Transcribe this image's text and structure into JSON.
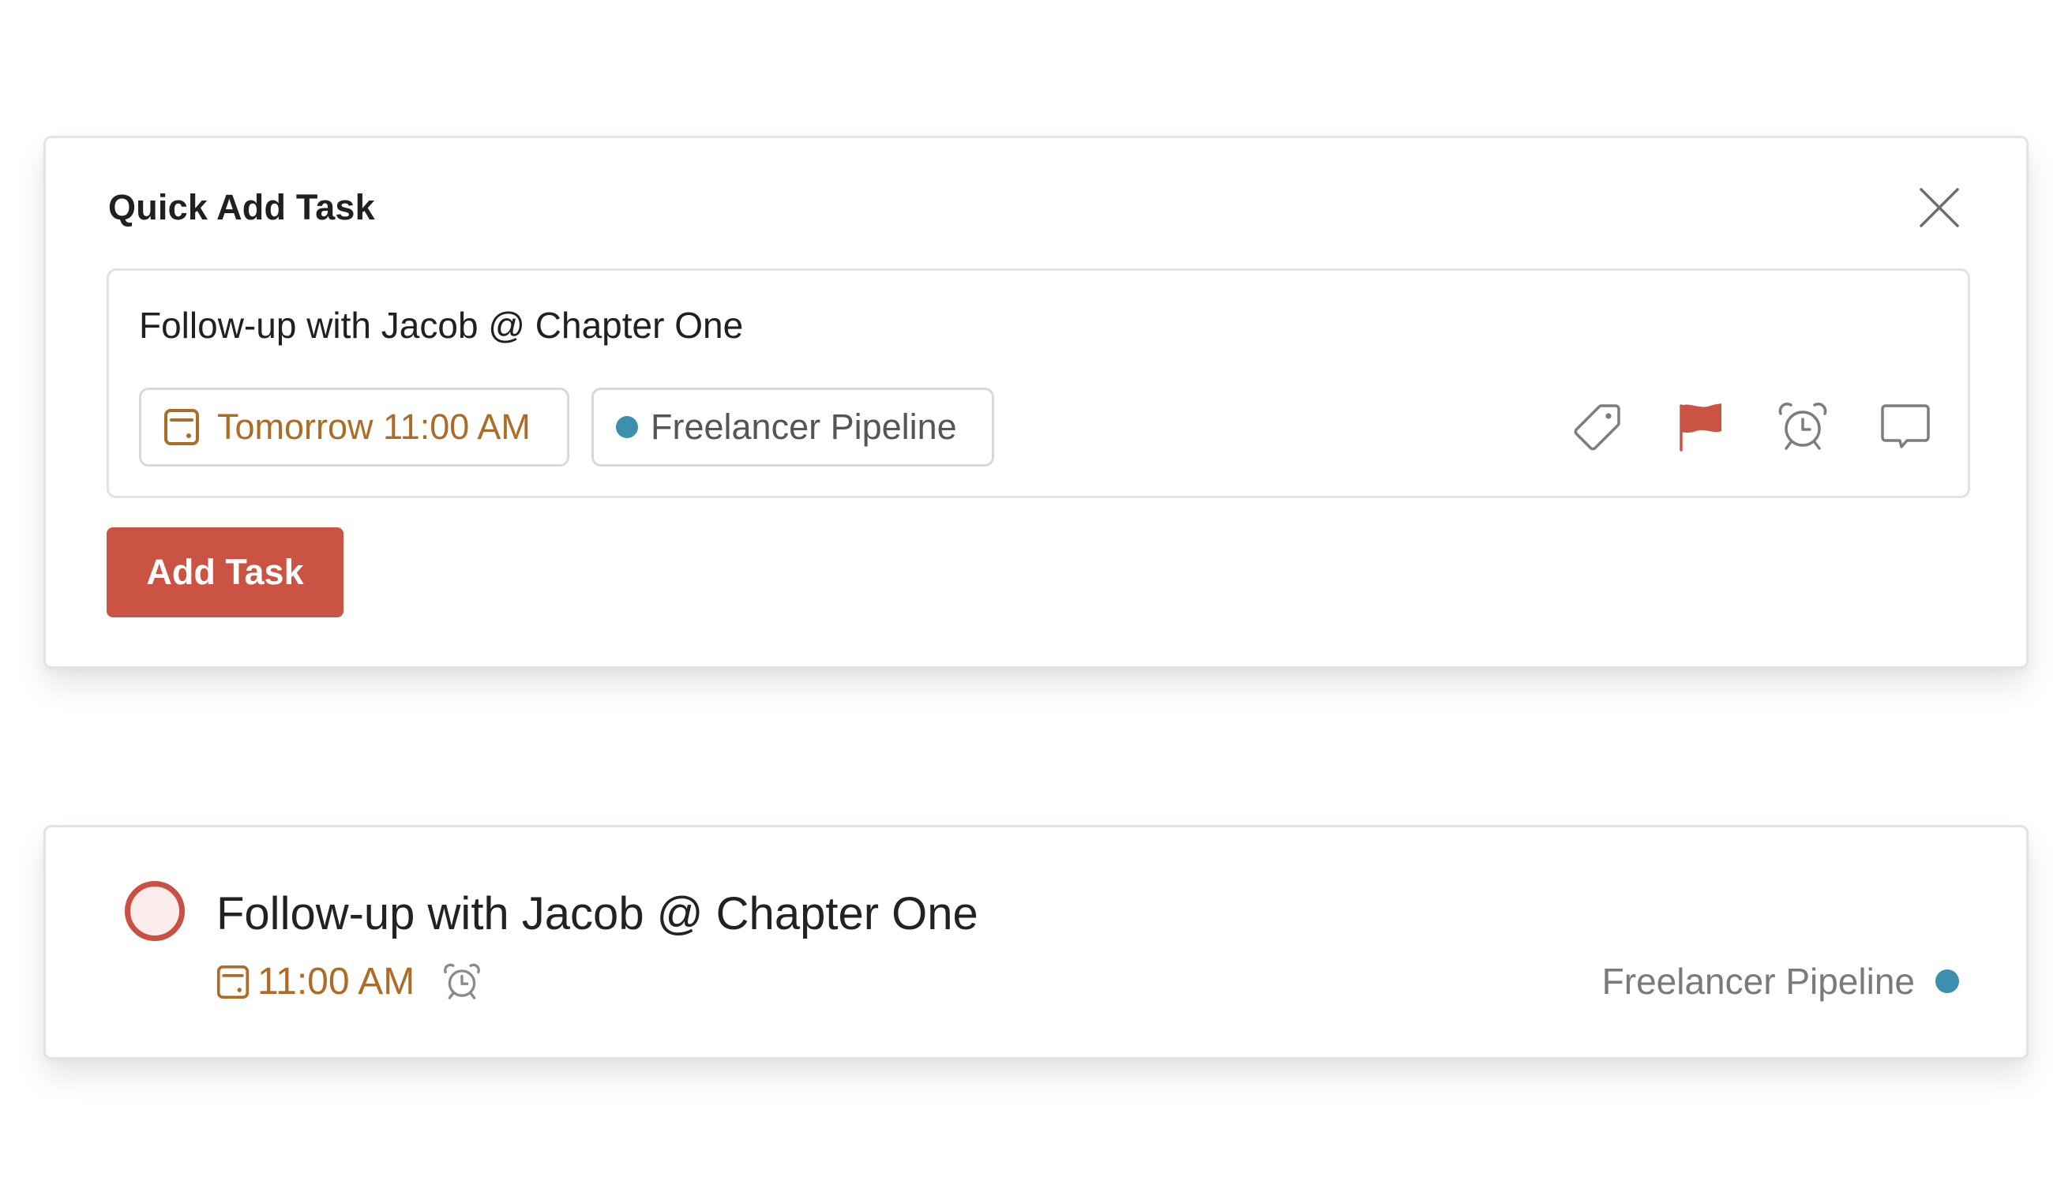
{
  "quick_add": {
    "title": "Quick Add Task",
    "close_label": "Close",
    "input_value": "Follow-up with Jacob @ Chapter One",
    "date_chip": {
      "icon": "calendar-icon",
      "label": "Tomorrow 11:00 AM",
      "color": "#ad6c26"
    },
    "project_chip": {
      "label": "Freelancer Pipeline",
      "dot_color": "#3d8fb0"
    },
    "tools": [
      {
        "icon": "label-tag-icon",
        "label": "Labels"
      },
      {
        "icon": "priority-flag-icon",
        "label": "Priority",
        "color": "#cb5343"
      },
      {
        "icon": "alarm-clock-icon",
        "label": "Reminders"
      },
      {
        "icon": "comment-icon",
        "label": "Comment"
      }
    ],
    "add_button_label": "Add Task",
    "add_button_color": "#cb5343"
  },
  "task_item": {
    "title": "Follow-up with Jacob @ Chapter One",
    "completed": false,
    "priority_color": "#cc4f43",
    "due_time": "11:00 AM",
    "has_reminder": true,
    "project": "Freelancer Pipeline",
    "project_color": "#3d8fb0"
  }
}
